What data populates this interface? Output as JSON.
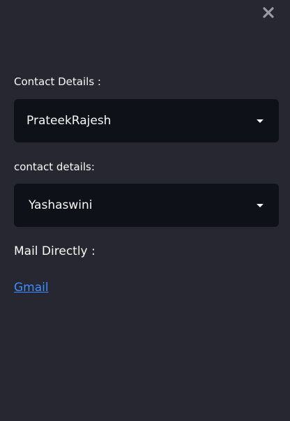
{
  "sidebar": {
    "close_icon": "close-icon",
    "contact_select_1": {
      "label": "Contact Details :",
      "value": "PrateekRajesh"
    },
    "contact_select_2": {
      "label": "contact details:",
      "value": "Yashaswini"
    },
    "mail_heading": "Mail Directly :",
    "mail_link": "Gmail"
  },
  "colors": {
    "background": "#262730",
    "select_background": "#0e1117",
    "text": "#fafafa",
    "link": "#3a8eff",
    "close_icon": "#9a9aa0"
  }
}
